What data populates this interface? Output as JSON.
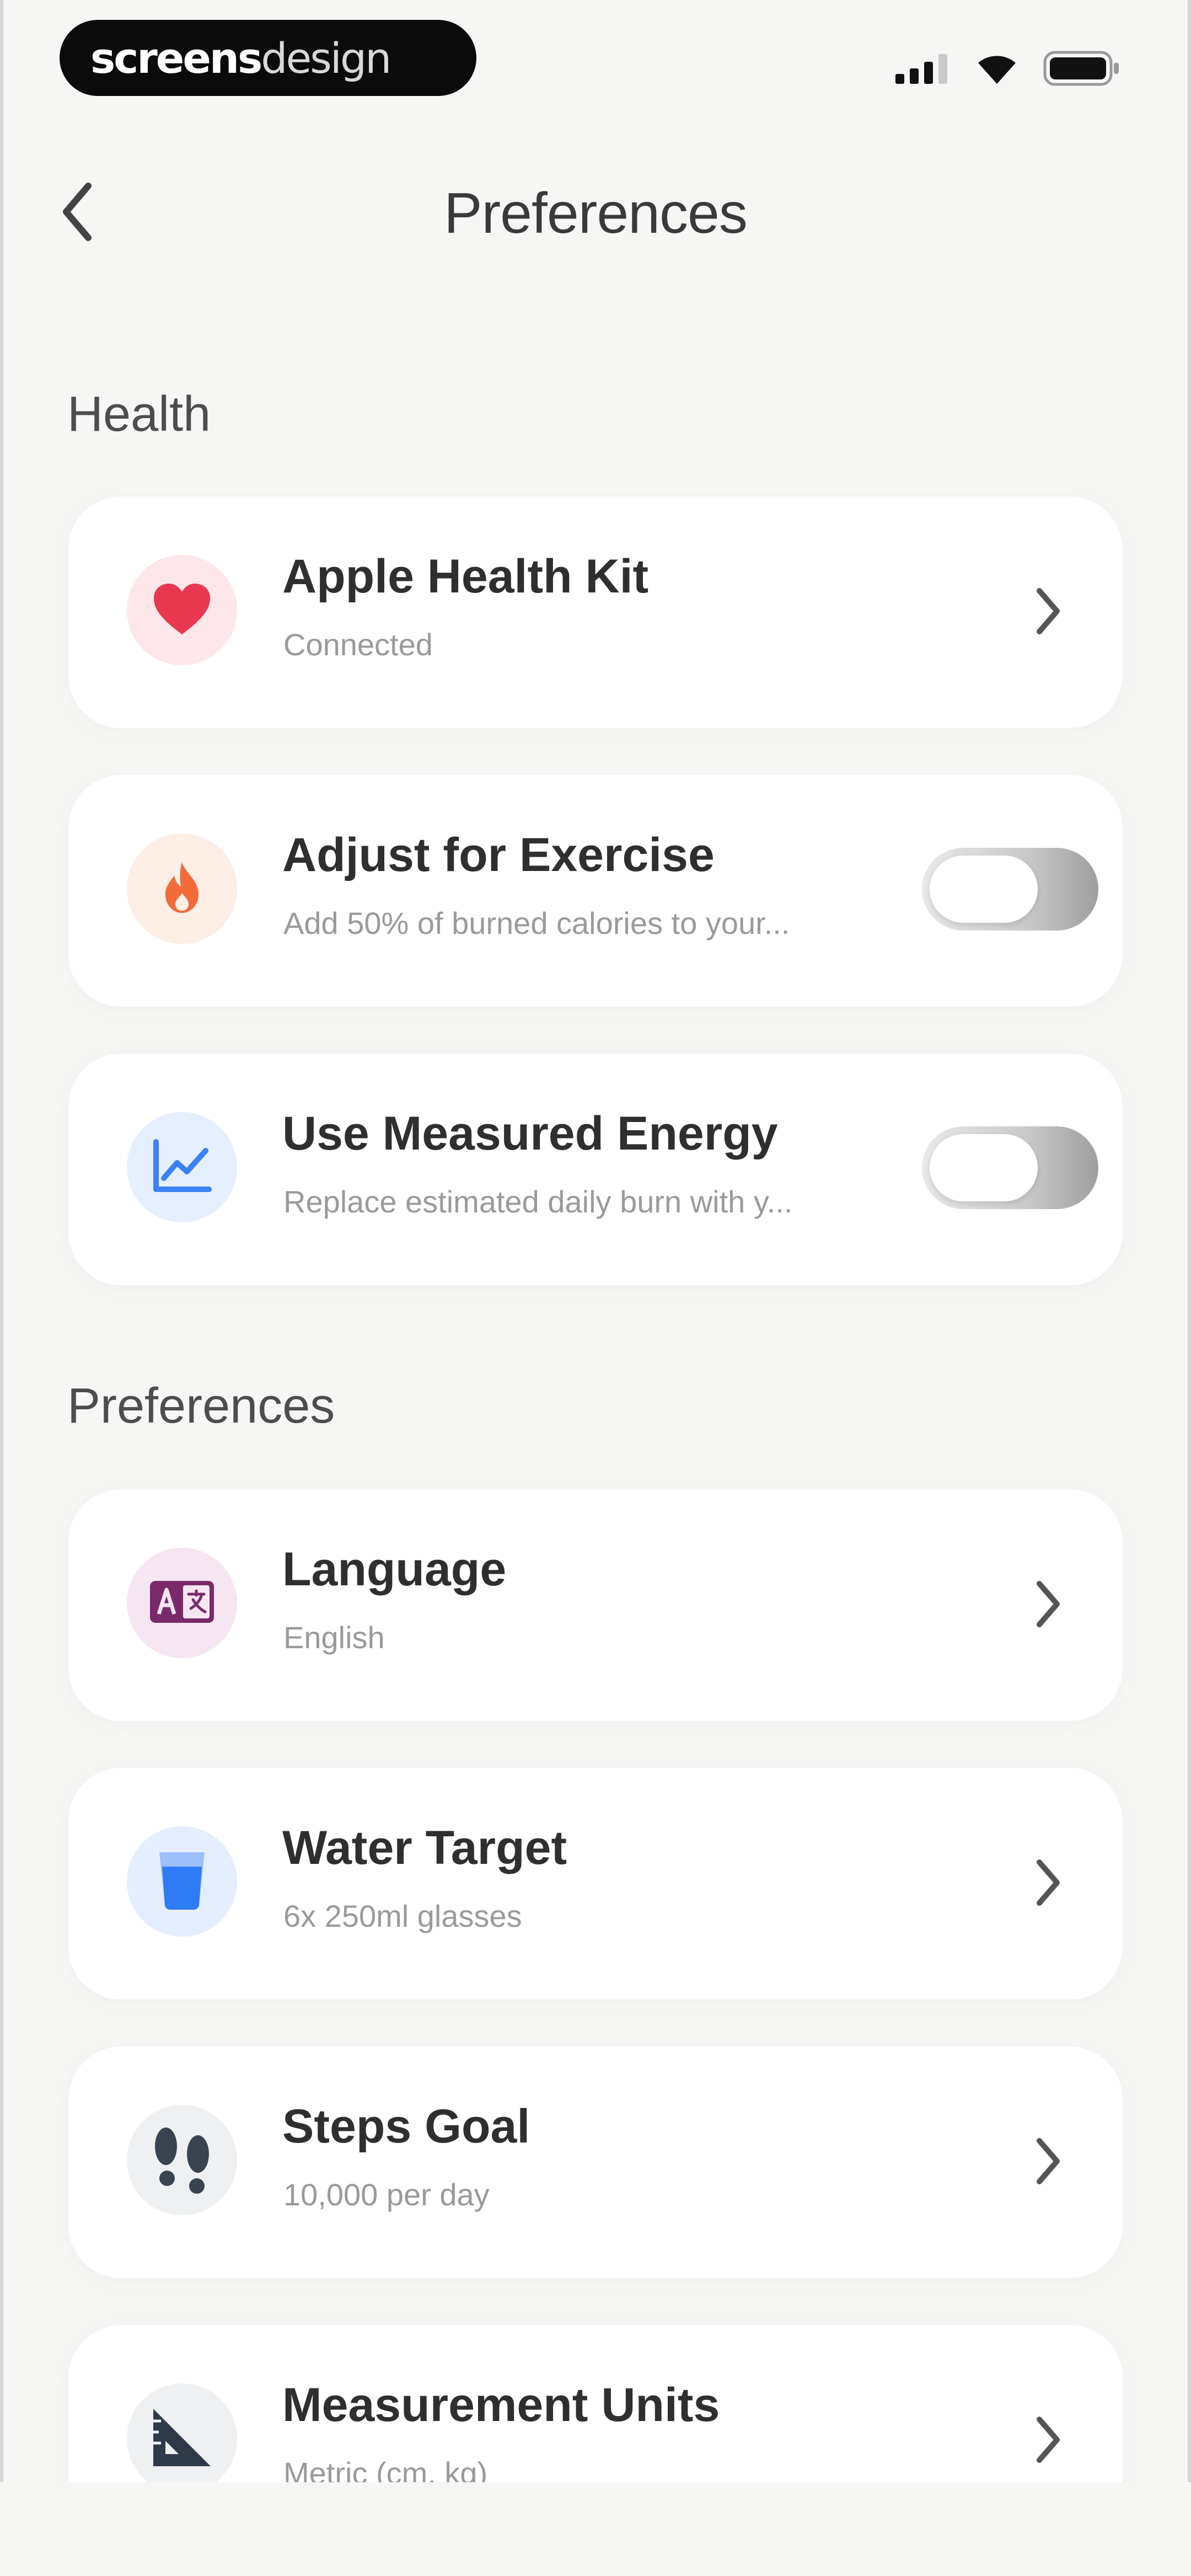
{
  "status_bar": {
    "watermark_bold": "screens",
    "watermark_light": "design",
    "icons": [
      "signal-icon",
      "wifi-icon",
      "battery-icon"
    ]
  },
  "nav": {
    "back_icon": "chevron-left-icon",
    "title": "Preferences"
  },
  "sections": {
    "health": {
      "title": "Health",
      "items": [
        {
          "title": "Apple Health Kit",
          "subtitle": "Connected",
          "icon": "heart-icon",
          "control": "chevron",
          "icon_color": "#e8384f",
          "bubble_color": "#fde7ea"
        },
        {
          "title": "Adjust for Exercise",
          "subtitle": "Add 50% of burned calories to your...",
          "icon": "flame-icon",
          "control": "toggle",
          "toggle_on": false,
          "icon_color": "#f26b38",
          "bubble_color": "#fdeee6"
        },
        {
          "title": "Use Measured Energy",
          "subtitle": "Replace estimated daily burn with y...",
          "icon": "chart-line-icon",
          "control": "toggle",
          "toggle_on": false,
          "icon_color": "#3b82f6",
          "bubble_color": "#e6effe"
        }
      ]
    },
    "preferences": {
      "title": "Preferences",
      "items": [
        {
          "title": "Language",
          "subtitle": "English",
          "icon": "language-icon",
          "control": "chevron",
          "icon_color": "#7a2a6a",
          "bubble_color": "#f5e6f2"
        },
        {
          "title": "Water Target",
          "subtitle": "6x 250ml glasses",
          "icon": "water-glass-icon",
          "control": "chevron",
          "icon_color": "#2f7bf5",
          "bubble_color": "#e4eefe"
        },
        {
          "title": "Steps Goal",
          "subtitle": "10,000 per day",
          "icon": "footprints-icon",
          "control": "chevron",
          "icon_color": "#3a4350",
          "bubble_color": "#eef0f2"
        },
        {
          "title": "Measurement Units",
          "subtitle": "Metric (cm, kg)",
          "icon": "ruler-triangle-icon",
          "control": "chevron",
          "icon_color": "#2e3a48",
          "bubble_color": "#eef0f2"
        }
      ]
    }
  }
}
